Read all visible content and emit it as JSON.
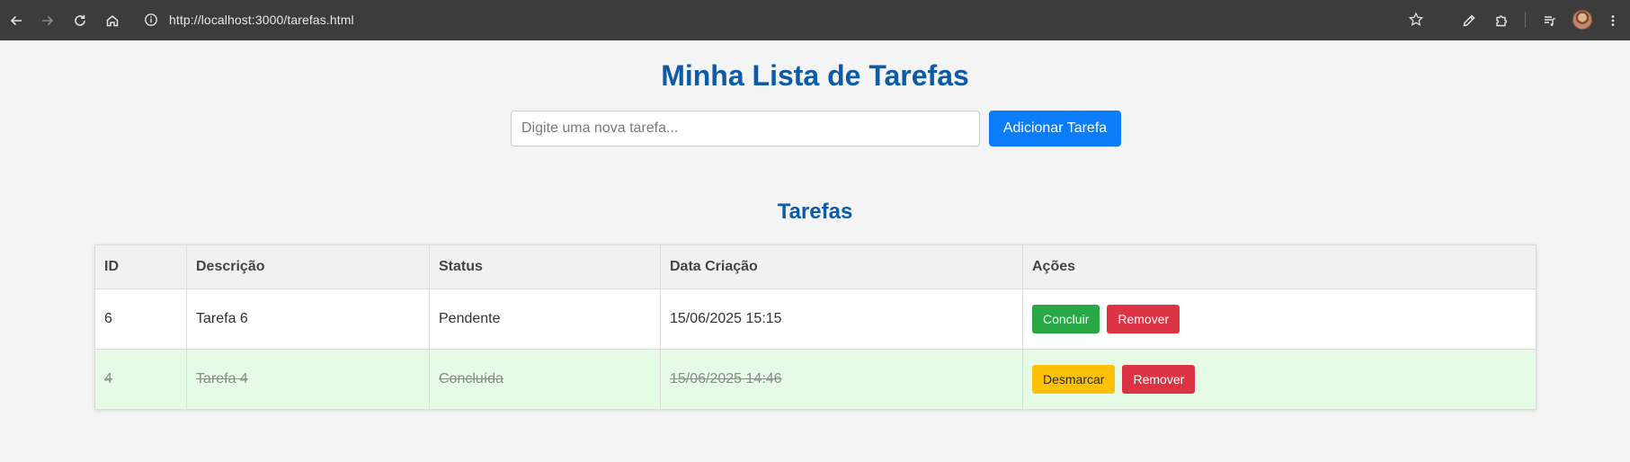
{
  "browser": {
    "url": "http://localhost:3000/tarefas.html",
    "icons": {
      "back": "back-arrow-icon",
      "forward": "forward-arrow-icon",
      "reload": "reload-icon",
      "home": "home-icon",
      "site_info": "info-icon",
      "bookmark": "star-icon",
      "extension_eyedropper": "eyedropper-icon",
      "extensions": "puzzle-icon",
      "media": "media-queue-icon",
      "profile": "avatar",
      "menu": "more-vert-icon"
    }
  },
  "page": {
    "title": "Minha Lista de Tarefas",
    "input_placeholder": "Digite uma nova tarefa...",
    "add_button": "Adicionar Tarefa",
    "section_title": "Tarefas",
    "colors": {
      "title": "#0d5aa7",
      "primary": "#0b7dfa",
      "success": "#27a844",
      "danger": "#dc3444",
      "warning": "#ffc107",
      "done_row_bg": "#e6fbe6"
    }
  },
  "table": {
    "headers": [
      "ID",
      "Descrição",
      "Status",
      "Data Criação",
      "Ações"
    ],
    "rows": [
      {
        "id": "6",
        "description": "Tarefa 6",
        "status": "Pendente",
        "created": "15/06/2025 15:15",
        "done": false,
        "toggle_label": "Concluir",
        "remove_label": "Remover"
      },
      {
        "id": "4",
        "description": "Tarefa 4",
        "status": "Concluída",
        "created": "15/06/2025 14:46",
        "done": true,
        "toggle_label": "Desmarcar",
        "remove_label": "Remover"
      }
    ]
  }
}
